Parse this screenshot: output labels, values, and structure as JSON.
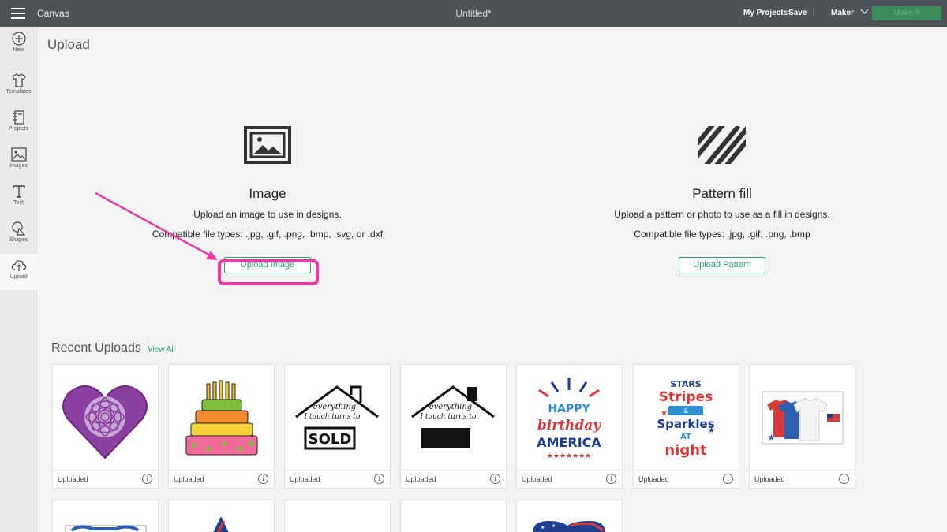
{
  "topbar": {
    "app_name": "Canvas",
    "doc_title": "Untitled*",
    "my_projects": "My Projects",
    "save": "Save",
    "separator": "|",
    "machine": "Maker",
    "make_it": "Make It"
  },
  "sidebar": {
    "items": [
      {
        "label": "New",
        "icon": "plus-circle-icon"
      },
      {
        "label": "Templates",
        "icon": "tshirt-icon"
      },
      {
        "label": "Projects",
        "icon": "notebook-icon"
      },
      {
        "label": "Images",
        "icon": "image-icon"
      },
      {
        "label": "Text",
        "icon": "text-t-icon"
      },
      {
        "label": "Shapes",
        "icon": "shapes-icon"
      },
      {
        "label": "Upload",
        "icon": "cloud-upload-icon",
        "active": true
      }
    ]
  },
  "page_title": "Upload",
  "image_section": {
    "icon": "image-icon",
    "heading": "Image",
    "description": "Upload an image to use in designs.",
    "file_types": "Compatible file types: .jpg, .gif, .png, .bmp, .svg, or .dxf",
    "button": "Upload Image"
  },
  "pattern_section": {
    "icon": "diagonal-stripes-icon",
    "heading": "Pattern fill",
    "description": "Upload a pattern or photo to use as a fill in designs.",
    "file_types": "Compatible file types: .jpg, .gif, .png, .bmp",
    "button": "Upload Pattern"
  },
  "recent": {
    "title": "Recent Uploads",
    "view_all": "View All",
    "items": [
      {
        "label": "Uploaded",
        "thumb": "purple-mandala-heart"
      },
      {
        "label": "Uploaded",
        "thumb": "birthday-cake"
      },
      {
        "label": "Uploaded",
        "thumb": "house-sold-sign",
        "text_lines": [
          "everything",
          "I touch turns to",
          "SOLD"
        ]
      },
      {
        "label": "Uploaded",
        "thumb": "house-black-sign",
        "text_lines": [
          "everything",
          "I touch turns to"
        ]
      },
      {
        "label": "Uploaded",
        "thumb": "happy-birthday-america",
        "text_lines": [
          "HAPPY",
          "birthday",
          "AMERICA"
        ]
      },
      {
        "label": "Uploaded",
        "thumb": "stars-stripes-sparkles",
        "text_lines": [
          "STARS",
          "Stripes",
          "&",
          "Sparkles",
          "AT",
          "night"
        ]
      },
      {
        "label": "Uploaded",
        "thumb": "tshirt-mockup"
      }
    ]
  },
  "colors": {
    "topbar": "#4a5459",
    "accent_green": "#2e9e6e",
    "highlight_pink": "#e83aa0"
  }
}
